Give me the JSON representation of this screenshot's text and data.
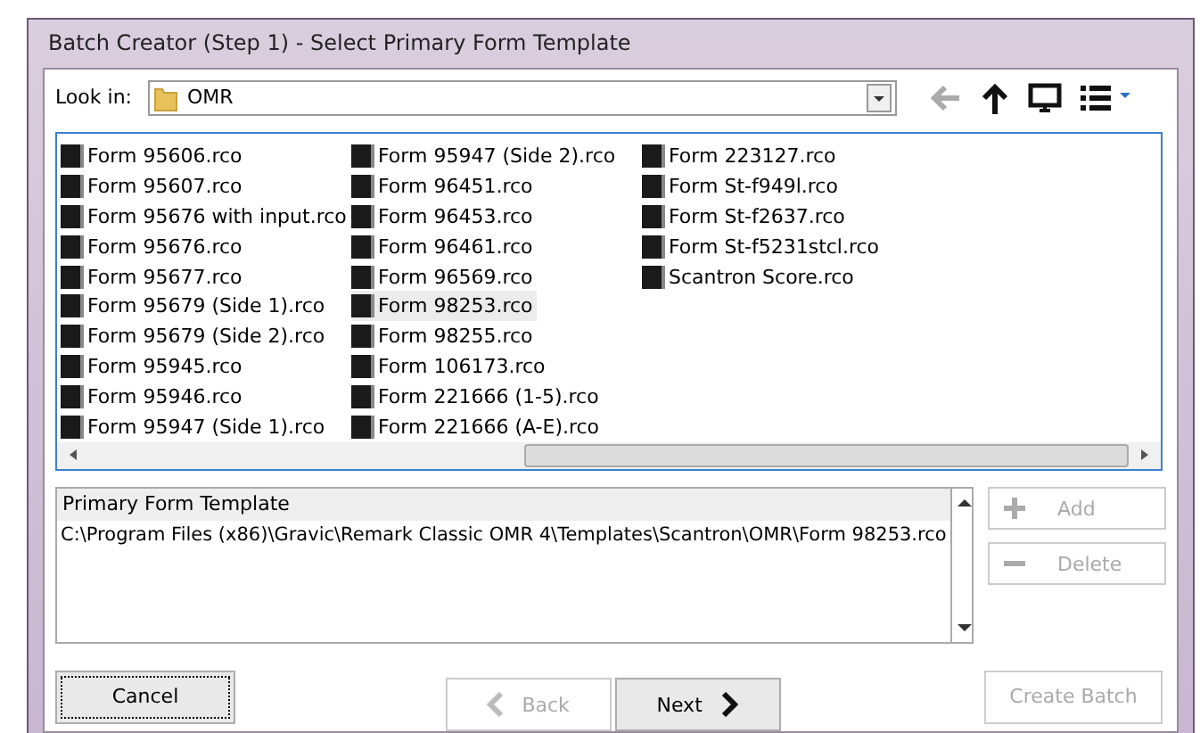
{
  "window": {
    "title": "Batch Creator (Step 1) - Select Primary Form Template"
  },
  "look_in": {
    "label": "Look in:",
    "value": "OMR"
  },
  "files": [
    {
      "name": "Form 95606.rco",
      "selected": false
    },
    {
      "name": "Form 95607.rco",
      "selected": false
    },
    {
      "name": "Form 95676 with input.rco",
      "selected": false
    },
    {
      "name": "Form 95676.rco",
      "selected": false
    },
    {
      "name": "Form 95677.rco",
      "selected": false
    },
    {
      "name": "Form 95679 (Side 1).rco",
      "selected": false
    },
    {
      "name": "Form 95679 (Side 2).rco",
      "selected": false
    },
    {
      "name": "Form 95945.rco",
      "selected": false
    },
    {
      "name": "Form 95946.rco",
      "selected": false
    },
    {
      "name": "Form 95947 (Side 1).rco",
      "selected": false
    },
    {
      "name": "Form 95947 (Side 2).rco",
      "selected": false
    },
    {
      "name": "Form 96451.rco",
      "selected": false
    },
    {
      "name": "Form 96453.rco",
      "selected": false
    },
    {
      "name": "Form 96461.rco",
      "selected": false
    },
    {
      "name": "Form 96569.rco",
      "selected": false
    },
    {
      "name": "Form 98253.rco",
      "selected": true
    },
    {
      "name": "Form 98255.rco",
      "selected": false
    },
    {
      "name": "Form 106173.rco",
      "selected": false
    },
    {
      "name": "Form 221666 (1-5).rco",
      "selected": false
    },
    {
      "name": "Form 221666 (A-E).rco",
      "selected": false
    },
    {
      "name": "Form 223127.rco",
      "selected": false
    },
    {
      "name": "Form St-f949l.rco",
      "selected": false
    },
    {
      "name": "Form St-f2637.rco",
      "selected": false
    },
    {
      "name": "Form St-f5231stcl.rco",
      "selected": false
    },
    {
      "name": "Scantron Score.rco",
      "selected": false
    }
  ],
  "template_panel": {
    "header": "Primary Form Template",
    "rows": [
      "C:\\Program Files (x86)\\Gravic\\Remark Classic OMR 4\\Templates\\Scantron\\OMR\\Form 98253.rco"
    ]
  },
  "side_buttons": [
    {
      "kind": "add",
      "label": "Add",
      "disabled": true
    },
    {
      "kind": "delete",
      "label": "Delete",
      "disabled": true
    }
  ],
  "footer_buttons": [
    {
      "kind": "cancel",
      "label": "Cancel",
      "disabled": false,
      "focused": true
    },
    {
      "kind": "back",
      "label": "Back",
      "disabled": true,
      "focused": false
    },
    {
      "kind": "next",
      "label": "Next",
      "disabled": false,
      "focused": false
    },
    {
      "kind": "create",
      "label": "Create Batch",
      "disabled": true,
      "focused": false
    }
  ]
}
